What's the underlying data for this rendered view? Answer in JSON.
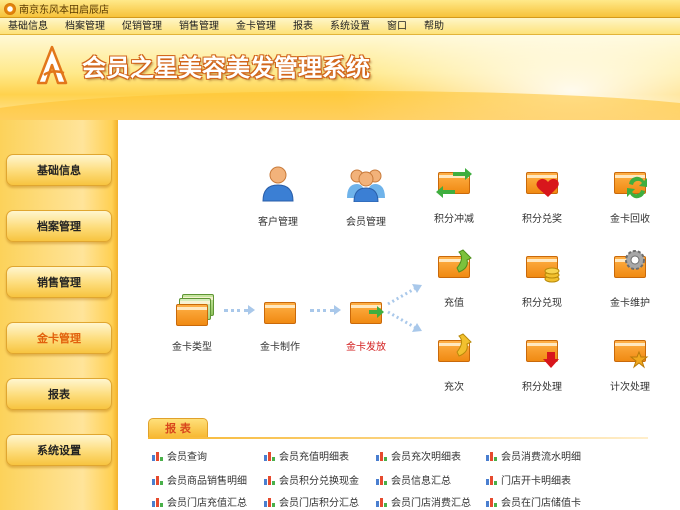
{
  "window": {
    "title": "南京东风本田启辰店"
  },
  "menu": [
    "基础信息",
    "档案管理",
    "促销管理",
    "销售管理",
    "金卡管理",
    "报表",
    "系统设置",
    "窗口",
    "帮助"
  ],
  "header": {
    "title": "会员之星美容美发管理系统"
  },
  "sidebar": {
    "items": [
      {
        "label": "基础信息"
      },
      {
        "label": "档案管理"
      },
      {
        "label": "销售管理"
      },
      {
        "label": "金卡管理",
        "active": true
      },
      {
        "label": "报表"
      },
      {
        "label": "系统设置"
      }
    ]
  },
  "flow": {
    "customer_mgmt": "客户管理",
    "member_mgmt": "会员管理",
    "points_offset": "积分冲减",
    "points_exchange": "积分兑奖",
    "card_recycle": "金卡回收",
    "card_type": "金卡类型",
    "card_make": "金卡制作",
    "card_issue": "金卡发放",
    "recharge": "充值",
    "points_cash": "积分兑现",
    "card_maintain": "金卡维护",
    "recharge_times": "充次",
    "points_process": "积分处理",
    "count_process": "计次处理"
  },
  "reports": {
    "tab_label": "报 表",
    "items": [
      "会员查询",
      "会员充值明细表",
      "会员充次明细表",
      "会员消费流水明细",
      "会员商品销售明细",
      "会员积分兑换现金",
      "会员信息汇总",
      "门店开卡明细表",
      "会员门店充值汇总",
      "会员门店积分汇总",
      "会员门店消费汇总",
      "会员在门店储值卡"
    ]
  },
  "colors": {
    "accent": "#f08a12",
    "highlight": "#d21d1d",
    "nav_active": "#e2610c"
  }
}
